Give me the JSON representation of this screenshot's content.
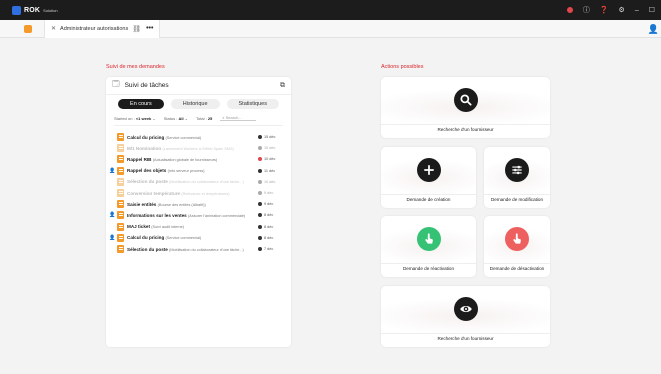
{
  "app": {
    "name": "ROK",
    "subtitle": "Solution"
  },
  "tab": {
    "label": "Administrateur autorisations"
  },
  "left_section_title": "Suivi de mes demandes",
  "right_section_title": "Actions possibles",
  "panel": {
    "title": "Suivi de tâches",
    "tabs": [
      "En cours",
      "Historique",
      "Statistiques"
    ],
    "filters": {
      "started_label": "Started on :",
      "started_value": "<1 week",
      "status_label": "Status :",
      "status_value": "All",
      "total_label": "Total :",
      "total_value": "25",
      "search_placeholder": "Search..."
    },
    "rows": [
      {
        "title": "Calcul du pricing",
        "sub": "(Service commercial)",
        "date": "15 déc",
        "status": "#333333",
        "faded": false,
        "person": false
      },
      {
        "title": "M/1 Nomination",
        "sub": "(Lancement Workers a-SHibb Spain SMS)",
        "date": "15 déc",
        "status": "#aaaaaa",
        "faded": true,
        "person": false
      },
      {
        "title": "Rappel RIB",
        "sub": "(Actualisation globale de fournisseurs)",
        "date": "10 déc",
        "status": "#e0464c",
        "faded": false,
        "person": false
      },
      {
        "title": "Rappel des objets",
        "sub": "(Info serveur process)",
        "date": "11 déc",
        "status": "#333333",
        "faded": false,
        "person": true
      },
      {
        "title": "Sélection du poste",
        "sub": "(Mobilisation du collaborateur d'une tâche...)",
        "date": "10 déc",
        "status": "#aaaaaa",
        "faded": true,
        "person": false
      },
      {
        "title": "Conversion température",
        "sub": "(Relevance et températures)",
        "date": "9 déc",
        "status": "#aaaaaa",
        "faded": true,
        "person": false
      },
      {
        "title": "Saisie entités",
        "sub": "(Bourse des entités (Albatif))",
        "date": "9 déc",
        "status": "#333333",
        "faded": false,
        "person": false
      },
      {
        "title": "Informations sur les ventes",
        "sub": "(Assurer l'animation commerciale)",
        "date": "8 déc",
        "status": "#333333",
        "faded": false,
        "person": true
      },
      {
        "title": "MAJ ticket",
        "sub": "(Suivi audit interne)",
        "date": "8 déc",
        "status": "#333333",
        "faded": false,
        "person": false
      },
      {
        "title": "Calcul du pricing",
        "sub": "(Service commercial)",
        "date": "8 déc",
        "status": "#333333",
        "faded": false,
        "person": true
      },
      {
        "title": "Sélection du poste",
        "sub": "(Mobilisation du collaborateur d'une tâche...)",
        "date": "7 déc",
        "status": "#333333",
        "faded": false,
        "person": false
      }
    ]
  },
  "actions": [
    {
      "label": "Recherche d'un fournisseur",
      "icon": "search-icon",
      "color": "#1b1b1b"
    },
    {
      "label": "Demande de création",
      "icon": "plus-icon",
      "color": "#1b1b1b"
    },
    {
      "label": "Demande de modification",
      "icon": "sliders-icon",
      "color": "#1b1b1b"
    },
    {
      "label": "Demande de réactivation",
      "icon": "hand-pointer-icon",
      "color": "#36c275"
    },
    {
      "label": "Demande de désactivation",
      "icon": "hand-pointer-icon",
      "color": "#ee5f5f"
    },
    {
      "label": "Recherche d'un fournisseur",
      "icon": "eye-icon",
      "color": "#1b1b1b"
    }
  ]
}
